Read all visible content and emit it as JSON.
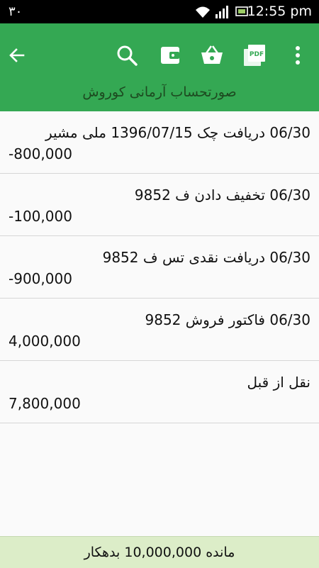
{
  "status_bar": {
    "left_indicator": "۳۰",
    "time": "12:55 pm"
  },
  "app_bar": {
    "title": "صورتحساب آرمانی کوروش",
    "actions": [
      "back-icon",
      "search-icon",
      "wallet-icon",
      "basket-icon",
      "pdf-icon",
      "more-vert-icon"
    ],
    "pdf_label": "PDF",
    "accent_color": "#34a853"
  },
  "transactions": [
    {
      "description": "06/30 دریافت چک 1396/07/15 ملی مشیر",
      "amount": "-800,000"
    },
    {
      "description": "06/30 تخفیف دادن ف 9852",
      "amount": "-100,000"
    },
    {
      "description": "06/30 دریافت نقدی تس ف 9852",
      "amount": "-900,000"
    },
    {
      "description": "06/30 فاکتور فروش 9852",
      "amount": "4,000,000"
    },
    {
      "description": "نقل از قبل",
      "amount": "7,800,000"
    }
  ],
  "footer": {
    "balance_text": "مانده 10,000,000 بدهکار"
  }
}
